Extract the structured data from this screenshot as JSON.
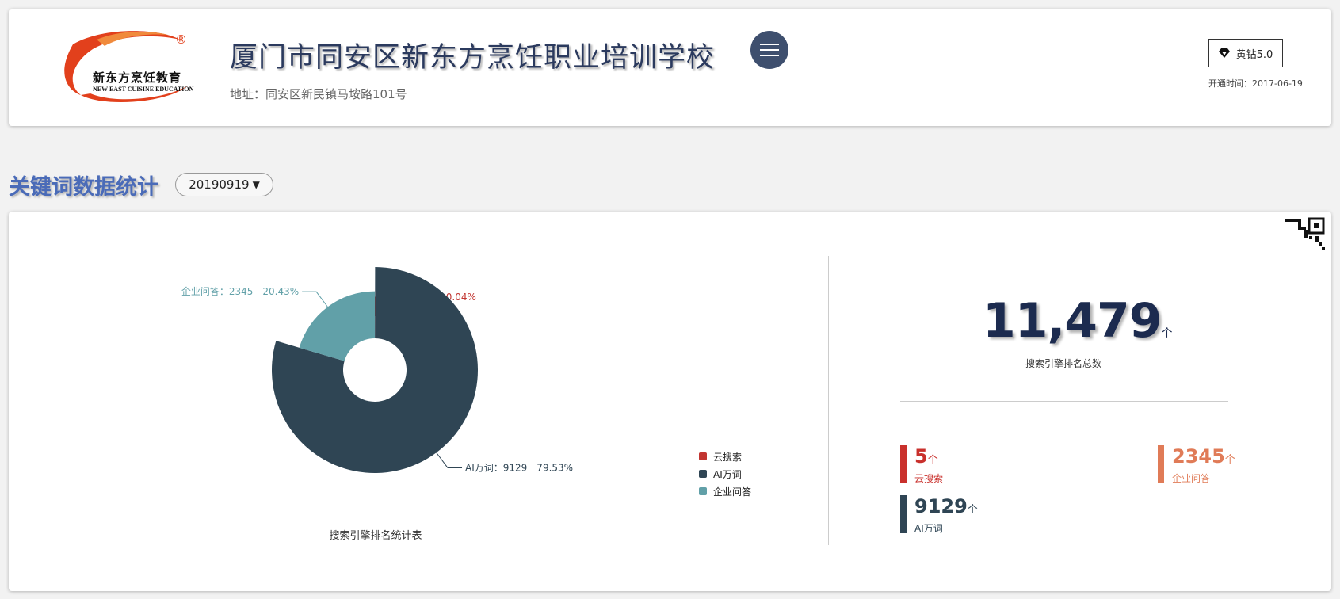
{
  "header": {
    "logo_text": "新东方烹饪教育",
    "logo_subtext": "NEW EAST CUISINE EDUCATION",
    "logo_reg": "®",
    "school_name": "厦门市同安区新东方烹饪职业培训学校",
    "address": "地址：同安区新民镇马垵路101号",
    "vip_label": "黄钻5.0",
    "open_date": "开通时间：2017-06-19"
  },
  "section": {
    "title": "关键词数据统计",
    "date_value": "20190919"
  },
  "chart_data": {
    "type": "pie",
    "title": "搜索引擎排名统计表",
    "slices": [
      {
        "name": "云搜索",
        "value": 5,
        "percent": "0.04%",
        "color": "#c23531",
        "label": "云搜索：5　0.04%"
      },
      {
        "name": "AI万词",
        "value": 9129,
        "percent": "79.53%",
        "color": "#2f4554",
        "label": "AI万词：9129　79.53%"
      },
      {
        "name": "企业问答",
        "value": 2345,
        "percent": "20.43%",
        "color": "#61a0a8",
        "label": "企业问答：2345　20.43%"
      }
    ],
    "legend": [
      "云搜索",
      "AI万词",
      "企业问答"
    ],
    "legend_position": "right"
  },
  "summary": {
    "total_value": "11,479",
    "unit": "个",
    "total_label": "搜索引擎排名总数",
    "stats": [
      {
        "value": "5",
        "unit": "个",
        "label": "云搜索",
        "color": "#c9302c"
      },
      {
        "value": "2345",
        "unit": "个",
        "label": "企业问答",
        "color": "#e07b57"
      },
      {
        "value": "9129",
        "unit": "个",
        "label": "AI万词",
        "color": "#2f4554"
      }
    ]
  },
  "icons": {
    "diamond": "diamond-icon",
    "menu": "menu-icon",
    "qr": "qr-code-icon",
    "dropdown": "caret-down-icon"
  }
}
